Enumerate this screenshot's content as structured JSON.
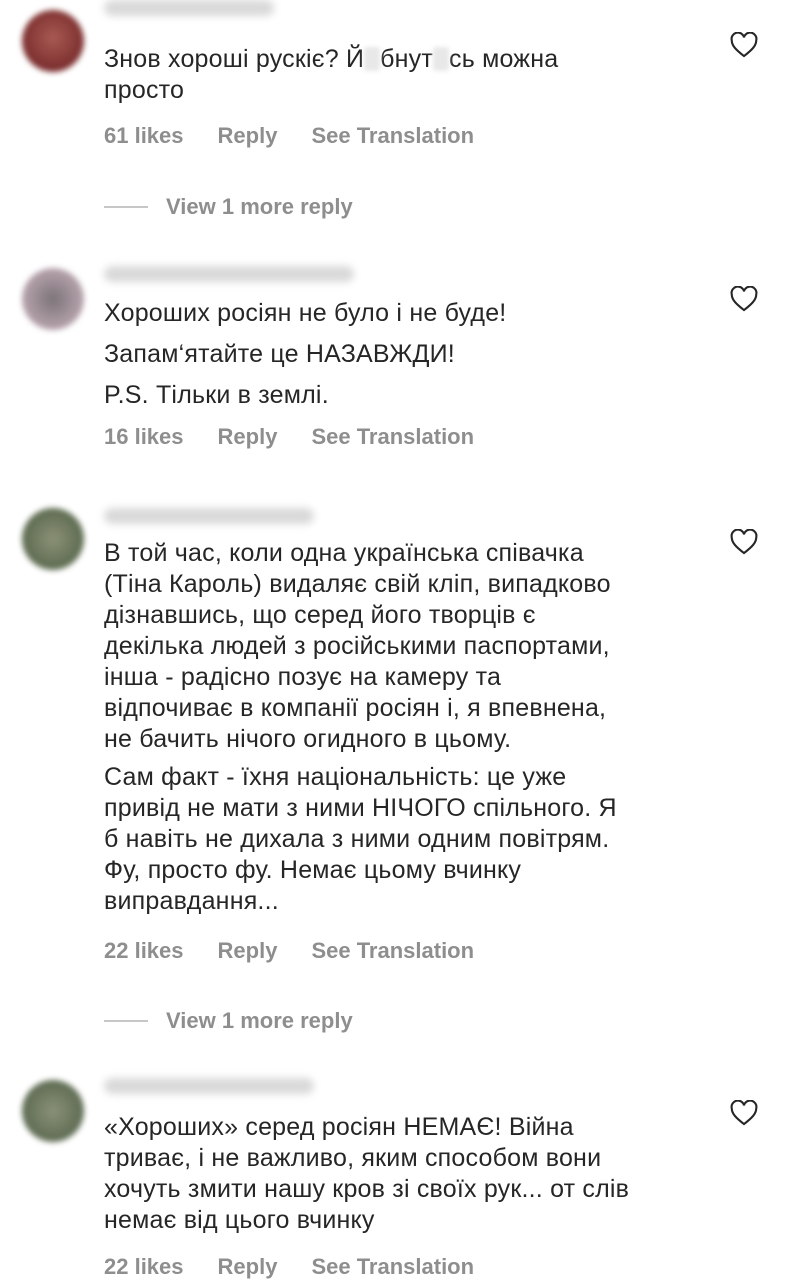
{
  "comments": [
    {
      "paragraphs": [],
      "text_parts": [
        "Знов хороші рускіє? Й",
        "бнут",
        "сь можна\nпросто"
      ],
      "likes": "61 likes",
      "reply": "Reply",
      "translate": "See Translation",
      "view_more": "View 1 more reply"
    },
    {
      "paragraphs": [
        "Хороших росіян не було і не буде!",
        "Запам‘ятайте це НАЗАВЖДИ!",
        "P.S. Тільки в землі."
      ],
      "likes": "16 likes",
      "reply": "Reply",
      "translate": "See Translation"
    },
    {
      "paragraphs": [
        "В той час, коли одна українська співачка\n(Тіна Кароль) видаляє свій кліп, випадково\nдізнавшись, що серед його творців є\nдекілька людей з російськими паспортами,\nінша - радісно позує на камеру та\nвідпочиває в компанії росіян і, я впевнена,\nне бачить нічого огидного в цьому.",
        "Сам факт - їхня національність: це уже\nпривід не мати з ними НІЧОГО спільного. Я\nб навіть не дихала з ними одним повітрям.\nФу, просто фу. Немає цьому вчинку\nвиправдання..."
      ],
      "likes": "22 likes",
      "reply": "Reply",
      "translate": "See Translation",
      "view_more": "View 1 more reply"
    },
    {
      "paragraphs": [
        "«Хороших» серед росіян НЕМАЄ! Війна\nтриває, і не важливо, яким способом вони\nхочуть змити нашу кров зі своїх рук... от слів\nнемає від цього вчинку"
      ],
      "likes": "22 likes",
      "reply": "Reply",
      "translate": "See Translation"
    }
  ],
  "colors": {
    "text": "#262626",
    "meta": "#8e8e8e",
    "avatars": [
      "#8a3b3b",
      "#8a7f86",
      "#6f7a5f",
      "#6b7760"
    ]
  },
  "icons": {
    "like": "heart-outline-icon"
  }
}
